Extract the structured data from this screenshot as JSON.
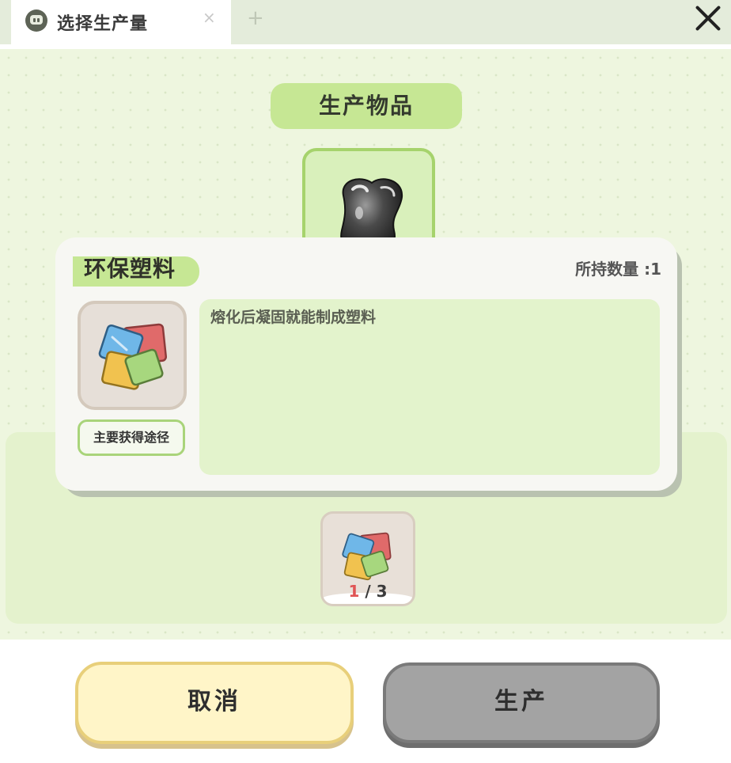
{
  "tab": {
    "title": "选择生产量",
    "close_glyph": "×",
    "add_glyph": "+",
    "icon": "robot-face-icon"
  },
  "window": {
    "close_icon": "close-x-icon"
  },
  "production": {
    "section_title": "生产物品",
    "product_icon": "metal-ore-icon"
  },
  "popup": {
    "item_name": "环保塑料",
    "owned_label": "所持数量 :1",
    "description": "熔化后凝固就能制成塑料",
    "source_button": "主要获得途径",
    "item_icon": "plastic-sheets-icon"
  },
  "materials": [
    {
      "icon": "plastic-sheets-icon",
      "have": "1",
      "separator": " / ",
      "need": "3"
    }
  ],
  "buttons": {
    "cancel": "取消",
    "produce": "生产"
  },
  "colors": {
    "accent_green": "#c6e794",
    "cancel_yellow": "#fff5c8",
    "disabled_gray": "#a3a3a3",
    "shortage_red": "#e05555"
  }
}
